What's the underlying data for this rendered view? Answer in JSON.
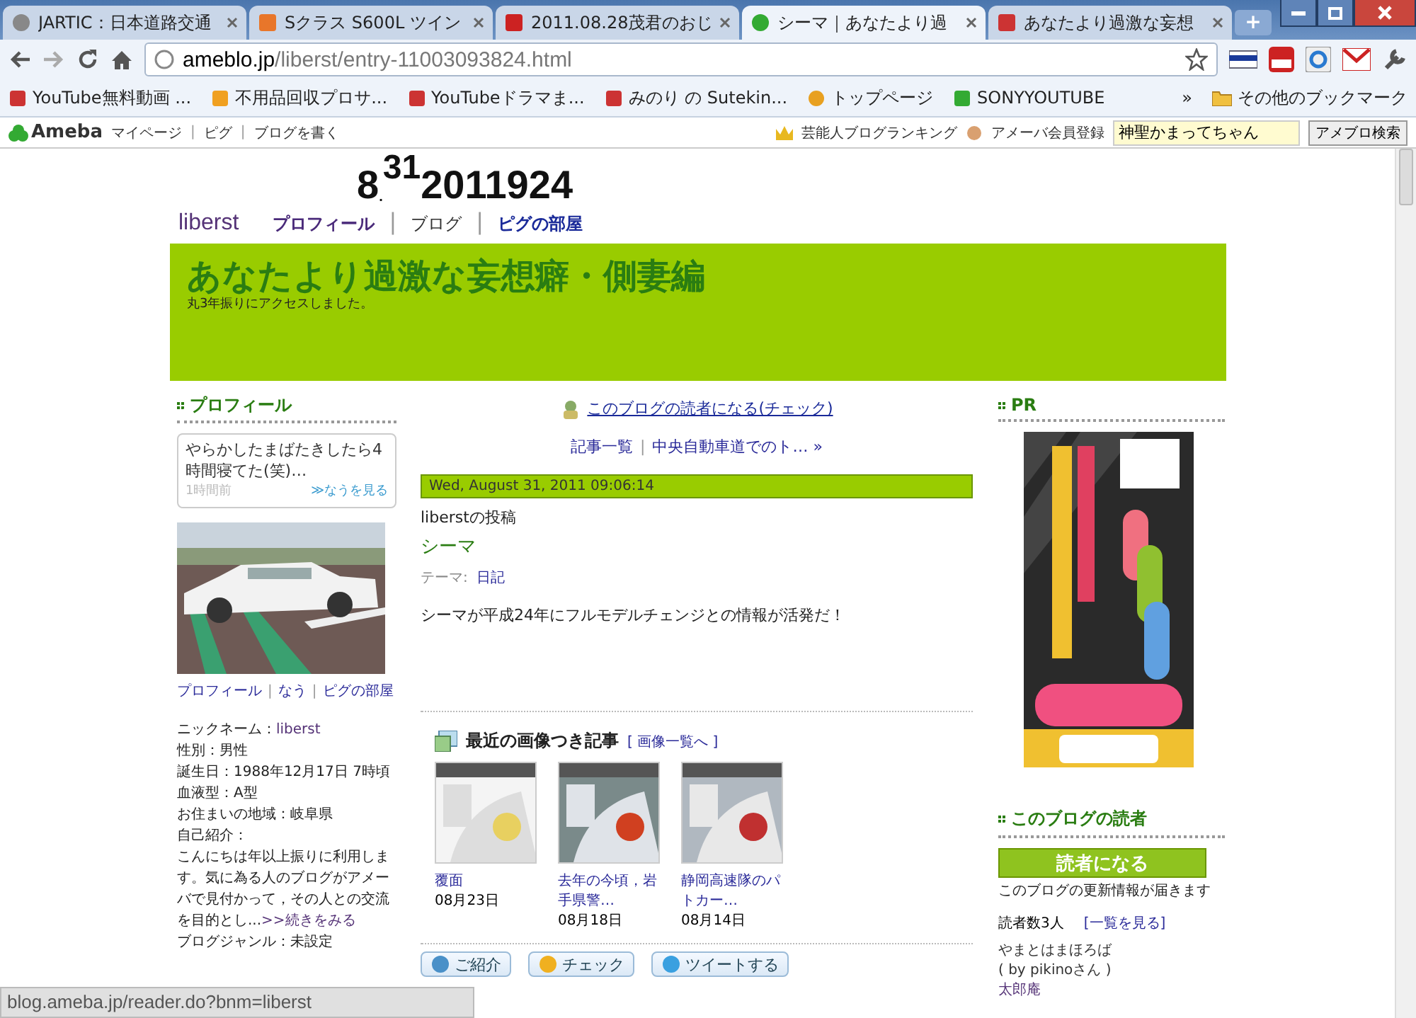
{
  "browser": {
    "tabs": [
      {
        "title": "JARTIC：日本道路交通",
        "selected": false
      },
      {
        "title": "Sクラス S600L ツイン",
        "selected": false
      },
      {
        "title": "2011.08.28茂君のおじ",
        "selected": false
      },
      {
        "title": "シーマ｜あなたより過",
        "selected": true
      },
      {
        "title": "あなたより過激な妄想",
        "selected": false
      }
    ],
    "new_tab": "+",
    "address": {
      "host": "ameblo.jp",
      "path": "/liberst/entry-11003093824.html"
    },
    "bookmarks": [
      "YouTube無料動画 ...",
      "不用品回収プロサ...",
      "YouTubeドラマま...",
      "みのり の Sutekin...",
      "トップページ",
      "SONYYOUTUBE"
    ],
    "bookmarks_overflow": "»",
    "other_bookmarks": "その他のブックマーク"
  },
  "ameba_bar": {
    "separator": "|",
    "logo": "Ameba",
    "links": [
      "マイページ",
      "ピグ",
      "ブログを書く"
    ],
    "ranking": "芸能人ブログランキング",
    "register": "アメーバ会員登録",
    "search_value": "神聖かまってちゃん",
    "search_button": "アメブロ検索"
  },
  "blog_header": {
    "separator": "|",
    "date_month": "8",
    "date_dot": ".",
    "date_day": "31",
    "date_rest": "2011924",
    "owner": "liberst",
    "nav": [
      "プロフィール",
      "ブログ",
      "ピグの部屋"
    ],
    "title": "あなたより過激な妄想癖・側妻編",
    "subtitle": "丸3年振りにアクセスしました。"
  },
  "profile": {
    "separator": "|",
    "heading": "プロフィール",
    "now": {
      "text": "やらかしたまばたきしたら4時間寝てた(笑)…",
      "time": "1時間前",
      "link": "≫なうを見る"
    },
    "links": [
      "プロフィール",
      "なう",
      "ピグの部屋"
    ],
    "details": [
      {
        "label": "ニックネーム：",
        "value": "liberst",
        "link": true
      },
      {
        "label": "性別：",
        "value": "男性",
        "link": false
      },
      {
        "label": "誕生日：",
        "value": "1988年12月17日 7時頃",
        "link": false
      },
      {
        "label": "血液型：",
        "value": "A型",
        "link": false
      },
      {
        "label": "お住まいの地域：",
        "value": "岐阜県",
        "link": false
      }
    ],
    "intro_label": "自己紹介：",
    "intro": "こんにちは年以上振りに利用します。気に為る人のブログがアメーバで見付かって，その人との交流を目的とし...",
    "more": ">>続きをみる",
    "genre": "ブログジャンル：未設定"
  },
  "entry": {
    "separator": "|",
    "reader_link": "このブログの読者になる(チェック)",
    "nav": [
      "記事一覧",
      "中央自動車道でのト… »"
    ],
    "date": "Wed, August 31, 2011 09:06:14",
    "author": "liberstの投稿",
    "title": "シーマ",
    "theme_label": "テーマ:",
    "theme": "日記",
    "body": "シーマが平成24年にフルモデルチェンジとの情報が活発だ！",
    "recent": {
      "heading": "最近の画像つき記事",
      "link": "[ 画像一覧へ ]",
      "items": [
        {
          "title": "覆面",
          "date": "08月23日"
        },
        {
          "title": "去年の今頃，岩手県警…",
          "date": "08月18日"
        },
        {
          "title": "静岡高速隊のパトカー…",
          "date": "08月14日"
        }
      ]
    },
    "share": [
      "ご紹介",
      "チェック",
      "ツイートする"
    ]
  },
  "sidebar": {
    "pr_heading": "PR",
    "readers_heading": "このブログの読者",
    "reader_button": "読者になる",
    "note": "このブログの更新情報が届きます",
    "count": "読者数3人",
    "list_link": "[一覧を見る]",
    "readers": [
      {
        "name": "やまとはまほろば",
        "by": "( by pikinoさん )"
      },
      {
        "name": "太郎庵"
      }
    ]
  },
  "status_bar": "blog.ameba.jp/reader.do?bnm=liberst"
}
